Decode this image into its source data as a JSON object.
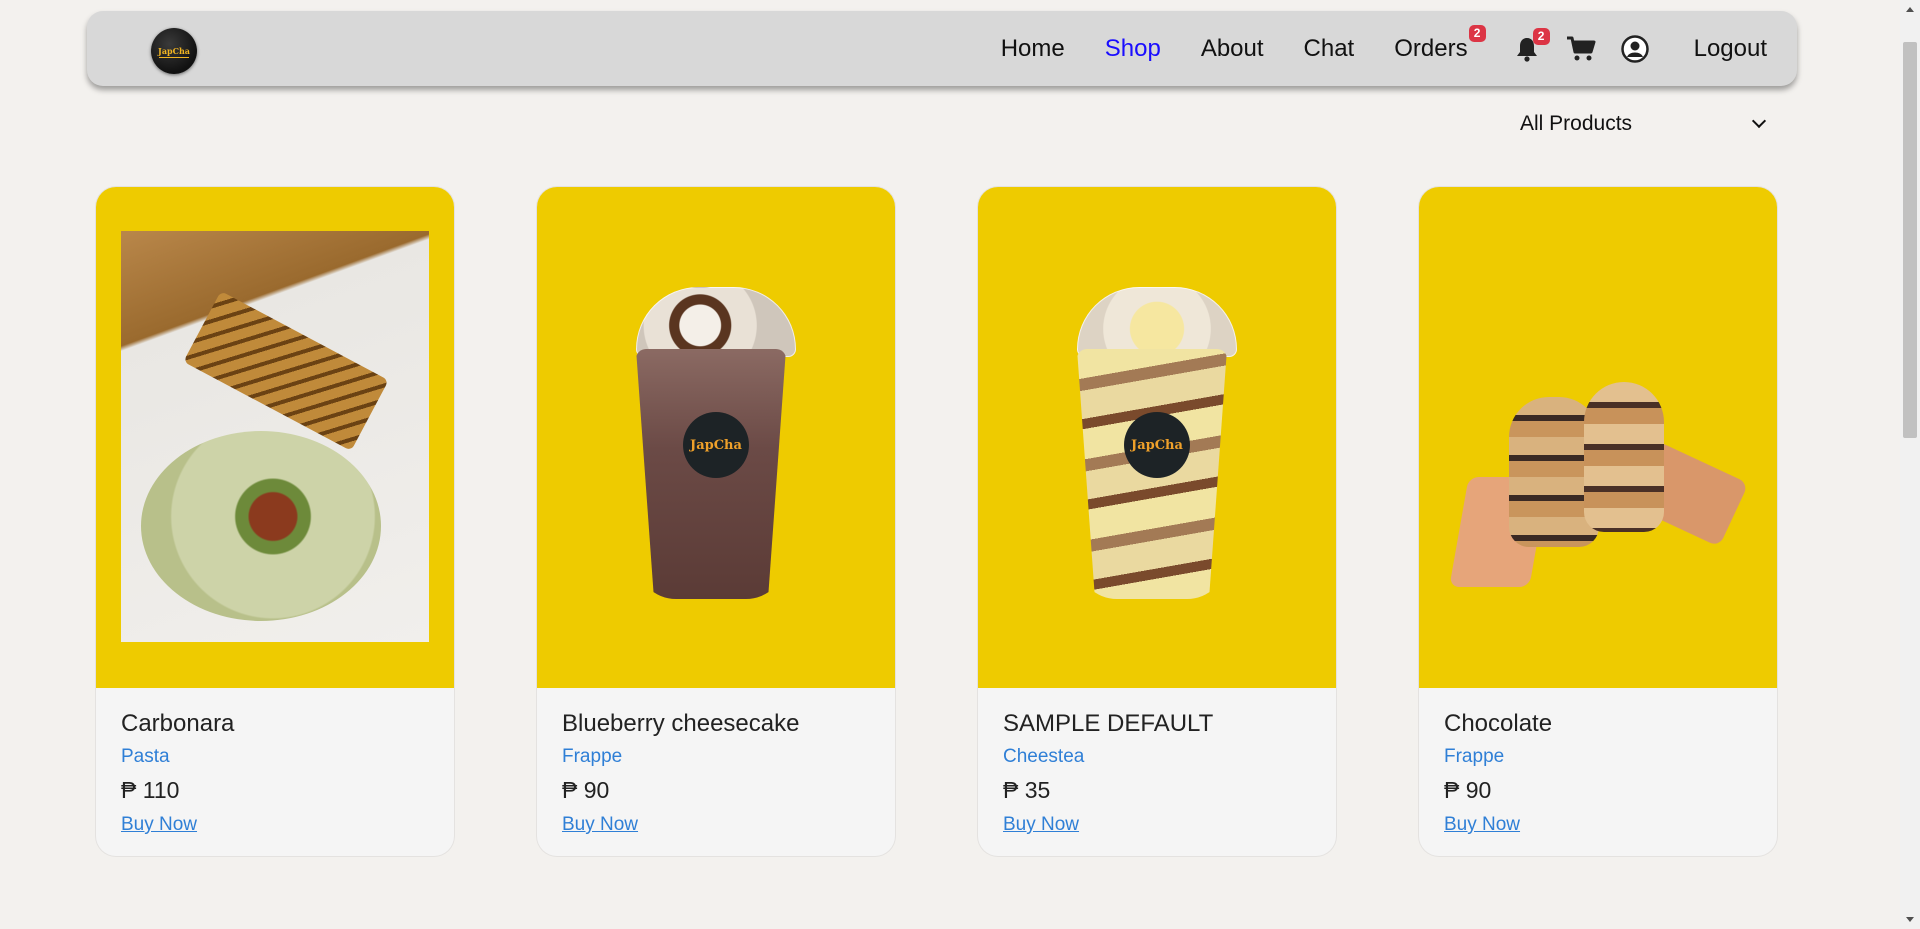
{
  "nav": {
    "logo_text": "JapCha",
    "links": [
      {
        "label": "Home",
        "active": false
      },
      {
        "label": "Shop",
        "active": true
      },
      {
        "label": "About",
        "active": false
      },
      {
        "label": "Chat",
        "active": false
      },
      {
        "label": "Orders",
        "active": false,
        "badge": "2"
      }
    ],
    "notifications_badge": "2",
    "logout_label": "Logout",
    "icons": [
      "bell-icon",
      "cart-icon",
      "user-icon"
    ]
  },
  "filter": {
    "selected": "All Products"
  },
  "products": [
    {
      "name": "Carbonara",
      "category": "Pasta",
      "price": "₱ 110",
      "action": "Buy Now",
      "image": "pasta-photo"
    },
    {
      "name": "Blueberry cheesecake",
      "category": "Frappe",
      "price": "₱ 90",
      "action": "Buy Now",
      "image": "chocolate-frappe-cup"
    },
    {
      "name": "SAMPLE DEFAULT",
      "category": "Cheestea",
      "price": "₱ 35",
      "action": "Buy Now",
      "image": "cheesetea-cup"
    },
    {
      "name": "Chocolate",
      "category": "Frappe",
      "price": "₱ 90",
      "action": "Buy Now",
      "image": "two-cups-photo"
    }
  ],
  "colors": {
    "background": "#f3f1ee",
    "navbar": "#d8d8d8",
    "card_image_bg": "#eecb00",
    "link_blue": "#2f7fd6",
    "active_nav": "#1a0dff",
    "badge_red": "#dc3545"
  }
}
